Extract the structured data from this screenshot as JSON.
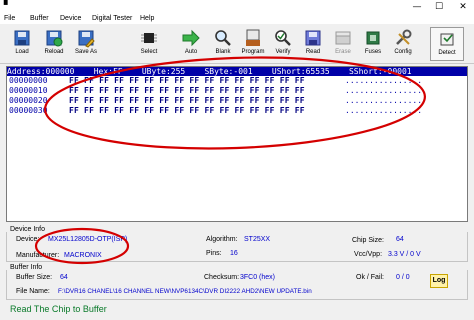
{
  "window": {
    "minimize_glyph": "—",
    "maximize_glyph": "☐",
    "close_glyph": "✕"
  },
  "menu": [
    "File",
    "Buffer",
    "Device",
    "Digital Tester",
    "Help"
  ],
  "toolbar": {
    "load": "Load",
    "reload": "Reload",
    "save_as": "Save As",
    "select": "Select",
    "auto": "Auto",
    "blank": "Blank",
    "program": "Program",
    "verify": "Verify",
    "read": "Read",
    "erase": "Erase",
    "fuses": "Fuses",
    "config": "Config",
    "detect": "Detect"
  },
  "hex": {
    "header": "Address:000000    Hex:FF    UByte:255    SByte:-001    UShort:65535    SShort:-00001",
    "rows": [
      {
        "addr": "00000000",
        "bytes": "FF FF FF FF FF FF FF FF FF FF FF FF FF FF FF FF",
        "ascii": "................"
      },
      {
        "addr": "00000010",
        "bytes": "FF FF FF FF FF FF FF FF FF FF FF FF FF FF FF FF",
        "ascii": "................"
      },
      {
        "addr": "00000020",
        "bytes": "FF FF FF FF FF FF FF FF FF FF FF FF FF FF FF FF",
        "ascii": "................"
      },
      {
        "addr": "00000030",
        "bytes": "FF FF FF FF FF FF FF FF FF FF FF FF FF FF FF FF",
        "ascii": "................"
      }
    ]
  },
  "device_info": {
    "title": "Device Info",
    "device_label": "Device:",
    "device_value": "MX25L12805D-OTP(ISP)",
    "manufacturer_label": "Manufacturer:",
    "manufacturer_value": "MACRONIX",
    "algorithm_label": "Algorithm:",
    "algorithm_value": "ST25XX",
    "pins_label": "Pins:",
    "pins_value": "16",
    "chip_size_label": "Chip Size:",
    "chip_size_value": "64",
    "vcc_label": "Vcc/Vpp:",
    "vcc_value": "3.3 V / 0 V"
  },
  "buffer_info": {
    "title": "Buffer Info",
    "size_label": "Buffer Size:",
    "size_value": "64",
    "checksum_label": "Checksum:",
    "checksum_value": "3FC0 (hex)",
    "okfail_label": "Ok / Fail:",
    "okfail_value": "0 / 0",
    "filename_label": "File Name:",
    "filename_value": "F:\\DVR16 CHANEL\\16 CHANNEL NEW\\NVP6134C\\DVR DI2222 AHD2\\NEW UPDATE.bin"
  },
  "log_label": "Log",
  "status": "Read The Chip to Buffer",
  "colors": {
    "header_bg": "#0000a8",
    "value_blue": "#0000cc",
    "annotation_red": "#d40000",
    "status_green": "#0a7a2a"
  }
}
